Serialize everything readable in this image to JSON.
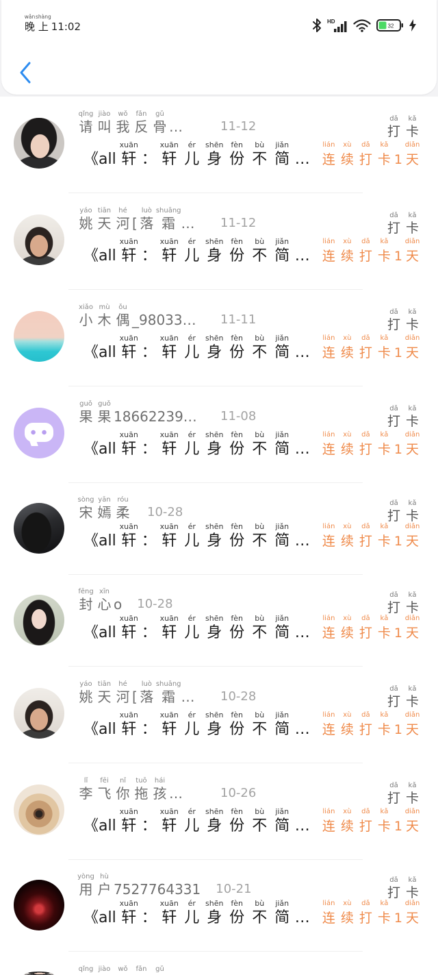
{
  "status_bar": {
    "time": [
      {
        "t": "晚",
        "py": "wǎn"
      },
      {
        "t": "上",
        "py": "shàng"
      },
      {
        "t": "11:02"
      }
    ],
    "network_label": "HD",
    "battery_level": "32",
    "icons": [
      "bluetooth-icon",
      "signal-icon",
      "wifi-icon",
      "battery-icon",
      "charging-icon"
    ]
  },
  "header": {
    "back_icon": "chevron-left-icon"
  },
  "colors": {
    "accent_blue": "#2d8cf0",
    "streak_orange": "#ef8a4a",
    "battery_green": "#4cd964"
  },
  "checkin": {
    "title": [
      {
        "t": "《all"
      },
      {
        "t": "轩",
        "py": "xuān"
      },
      {
        "t": "："
      },
      {
        "t": "轩",
        "py": "xuān"
      },
      {
        "t": "儿",
        "py": "ér"
      },
      {
        "t": "身",
        "py": "shēn"
      },
      {
        "t": "份",
        "py": "fèn"
      },
      {
        "t": "不",
        "py": "bù"
      },
      {
        "t": "简",
        "py": "jiǎn"
      },
      {
        "t": "…"
      }
    ],
    "action": [
      {
        "t": "打",
        "py": "dǎ"
      },
      {
        "t": "卡",
        "py": "kǎ"
      }
    ],
    "streak": [
      {
        "t": "连",
        "py": "lián"
      },
      {
        "t": "续",
        "py": "xù"
      },
      {
        "t": "打",
        "py": "dǎ"
      },
      {
        "t": "卡",
        "py": "kǎ"
      },
      {
        "t": "1"
      },
      {
        "t": "天",
        "py": "diǎn"
      }
    ]
  },
  "rows": [
    {
      "avatar": "avatar-portrait-icon",
      "name": [
        {
          "t": "请",
          "py": "qǐng"
        },
        {
          "t": "叫",
          "py": "jiào"
        },
        {
          "t": "我",
          "py": "wǒ"
        },
        {
          "t": "反",
          "py": "fǎn"
        },
        {
          "t": "骨",
          "py": "gǔ"
        },
        {
          "t": "…"
        }
      ],
      "date": "11-12"
    },
    {
      "avatar": "avatar-selfie-icon",
      "name": [
        {
          "t": "姚",
          "py": "yáo"
        },
        {
          "t": "天",
          "py": "tiān"
        },
        {
          "t": "河",
          "py": "hé"
        },
        {
          "t": "["
        },
        {
          "t": "落",
          "py": "luò"
        },
        {
          "t": "霜",
          "py": "shuāng"
        },
        {
          "t": "…"
        }
      ],
      "date": "11-12"
    },
    {
      "avatar": "avatar-beach-icon",
      "name": [
        {
          "t": "小",
          "py": "xiǎo"
        },
        {
          "t": "木",
          "py": "mù"
        },
        {
          "t": "偶",
          "py": "ǒu"
        },
        {
          "t": "_98033"
        },
        {
          "t": "…"
        }
      ],
      "date": "11-11"
    },
    {
      "avatar": "avatar-chat-bubble-icon",
      "name": [
        {
          "t": "果",
          "py": "guǒ"
        },
        {
          "t": "果",
          "py": "guǒ"
        },
        {
          "t": "18662239"
        },
        {
          "t": "…"
        }
      ],
      "date": "11-08"
    },
    {
      "avatar": "avatar-hooded-figure-icon",
      "name": [
        {
          "t": "宋",
          "py": "sòng"
        },
        {
          "t": "嫣",
          "py": "yān"
        },
        {
          "t": "柔",
          "py": "róu"
        }
      ],
      "date": "10-28"
    },
    {
      "avatar": "avatar-girl-icon",
      "name": [
        {
          "t": "封",
          "py": "fēng"
        },
        {
          "t": "心",
          "py": "xīn"
        },
        {
          "t": "o"
        }
      ],
      "date": "10-28"
    },
    {
      "avatar": "avatar-selfie-icon",
      "name": [
        {
          "t": "姚",
          "py": "yáo"
        },
        {
          "t": "天",
          "py": "tiān"
        },
        {
          "t": "河",
          "py": "hé"
        },
        {
          "t": "["
        },
        {
          "t": "落",
          "py": "luò"
        },
        {
          "t": "霜",
          "py": "shuāng"
        },
        {
          "t": "…"
        }
      ],
      "date": "10-28"
    },
    {
      "avatar": "avatar-dog-icon",
      "name": [
        {
          "t": "李",
          "py": "lǐ"
        },
        {
          "t": "飞",
          "py": "fēi"
        },
        {
          "t": "你",
          "py": "nǐ"
        },
        {
          "t": "拖",
          "py": "tuō"
        },
        {
          "t": "孩",
          "py": "hái"
        },
        {
          "t": "…"
        }
      ],
      "date": "10-26"
    },
    {
      "avatar": "avatar-red-figure-icon",
      "name": [
        {
          "t": "用",
          "py": "yòng"
        },
        {
          "t": "户",
          "py": "hù"
        },
        {
          "t": "7527764331"
        }
      ],
      "date": "10-21"
    },
    {
      "avatar": "avatar-portrait-icon",
      "name": [
        {
          "py": "qǐng"
        },
        {
          "py": "jiào"
        },
        {
          "py": "wǒ"
        },
        {
          "py": "fǎn"
        },
        {
          "py": "gǔ"
        }
      ]
    }
  ]
}
